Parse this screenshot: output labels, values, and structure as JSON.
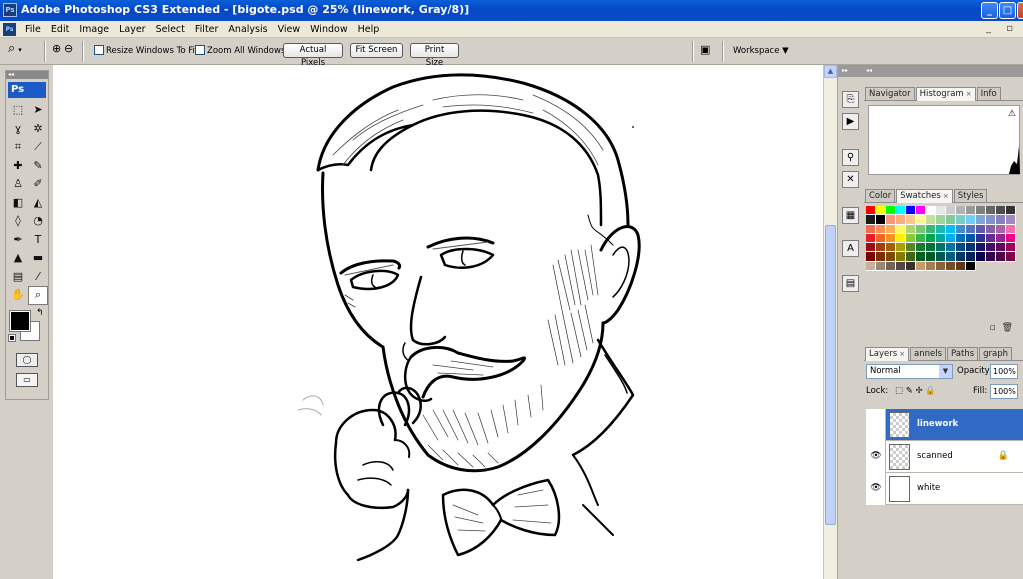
{
  "window": {
    "title": "Adobe Photoshop CS3 Extended - [bigote.psd @ 25% (linework, Gray/8)]",
    "app_badge": "Ps",
    "buttons": {
      "minimize": "_",
      "maximize": "□",
      "close": "×"
    }
  },
  "menubar": {
    "items": [
      "File",
      "Edit",
      "Image",
      "Layer",
      "Select",
      "Filter",
      "Analysis",
      "View",
      "Window",
      "Help"
    ],
    "doc_controls": "_ ▫"
  },
  "options_bar": {
    "tool_icon": "zoom-icon",
    "resize_windows_label": "Resize Windows To Fit",
    "zoom_all_windows_label": "Zoom All Windows",
    "actual_pixels": "Actual Pixels",
    "fit_screen": "Fit Screen",
    "print_size": "Print Size",
    "workspace": "Workspace ▼"
  },
  "toolbox": {
    "logo": "Ps",
    "tools": [
      {
        "name": "marquee-tool",
        "glyph": "⬚"
      },
      {
        "name": "move-tool",
        "glyph": "➤"
      },
      {
        "name": "lasso-tool",
        "glyph": "ɣ"
      },
      {
        "name": "magic-wand-tool",
        "glyph": "✲"
      },
      {
        "name": "crop-tool",
        "glyph": "⌗"
      },
      {
        "name": "slice-tool",
        "glyph": "⟋"
      },
      {
        "name": "healing-brush-tool",
        "glyph": "✚"
      },
      {
        "name": "brush-tool",
        "glyph": "✎"
      },
      {
        "name": "clone-stamp-tool",
        "glyph": "♙"
      },
      {
        "name": "history-brush-tool",
        "glyph": "✐"
      },
      {
        "name": "eraser-tool",
        "glyph": "◧"
      },
      {
        "name": "paint-bucket-tool",
        "glyph": "◭"
      },
      {
        "name": "blur-tool",
        "glyph": "◊"
      },
      {
        "name": "dodge-tool",
        "glyph": "◔"
      },
      {
        "name": "pen-tool",
        "glyph": "✒"
      },
      {
        "name": "type-tool",
        "glyph": "T"
      },
      {
        "name": "path-selection-tool",
        "glyph": "▲"
      },
      {
        "name": "shape-tool",
        "glyph": "▬"
      },
      {
        "name": "notes-tool",
        "glyph": "▤"
      },
      {
        "name": "eyedropper-tool",
        "glyph": "⁄"
      },
      {
        "name": "hand-tool",
        "glyph": "✋"
      },
      {
        "name": "zoom-tool",
        "glyph": "⌕"
      }
    ],
    "active_tool": "zoom-tool",
    "foreground_color": "#000000",
    "background_color": "#ffffff"
  },
  "panels": {
    "group1_tabs": [
      "Navigator",
      "Histogram",
      "Info"
    ],
    "group1_active": "Histogram",
    "group2_tabs": [
      "Color",
      "Swatches",
      "Styles"
    ],
    "group2_active": "Swatches",
    "group3_tabs": [
      "Layers",
      "annels",
      "Paths",
      "graph"
    ],
    "group3_active": "Layers",
    "blend_mode": "Normal",
    "opacity_label": "Opacity:",
    "opacity_value": "100%",
    "lock_label": "Lock:",
    "fill_label": "Fill:",
    "fill_value": "100%",
    "layers": [
      {
        "name": "linework",
        "selected": true,
        "transparent": true,
        "locked": false
      },
      {
        "name": "scanned",
        "selected": false,
        "transparent": true,
        "locked": true
      },
      {
        "name": "white",
        "selected": false,
        "transparent": false,
        "locked": false
      }
    ]
  },
  "colors": {
    "titlebar": "#0548c4",
    "selection": "#316ac5",
    "chrome": "#d4d0c8"
  }
}
